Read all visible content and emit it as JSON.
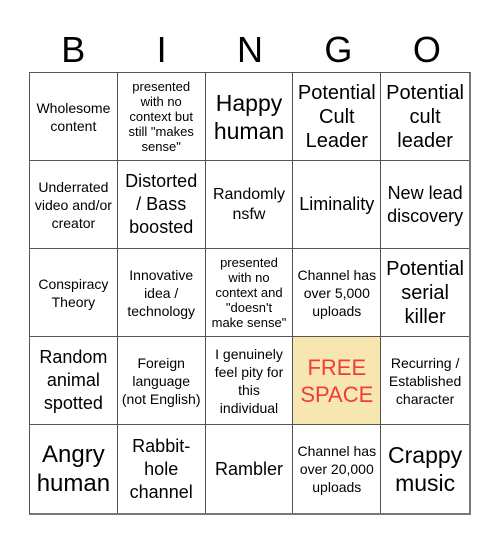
{
  "header": {
    "letters": [
      "B",
      "I",
      "N",
      "G",
      "O"
    ]
  },
  "free_space": {
    "background": "#f7e6b0",
    "text_color": "#f03c3c"
  },
  "cells": [
    {
      "text": "Wholesome content"
    },
    {
      "text": "presented with no context but still \"makes sense\""
    },
    {
      "text": "Happy human"
    },
    {
      "text": "Potential Cult Leader"
    },
    {
      "text": "Potential cult leader"
    },
    {
      "text": "Underrated video and/or creator"
    },
    {
      "text": "Distorted / Bass boosted"
    },
    {
      "text": "Randomly nsfw"
    },
    {
      "text": "Liminality"
    },
    {
      "text": "New lead discovery"
    },
    {
      "text": "Conspiracy Theory"
    },
    {
      "text": "Innovative idea / technology"
    },
    {
      "text": "presented with no context and \"doesn't make sense\""
    },
    {
      "text": "Channel has over 5,000 uploads"
    },
    {
      "text": "Potential serial killer"
    },
    {
      "text": "Random animal spotted"
    },
    {
      "text": "Foreign language (not English)"
    },
    {
      "text": "I genuinely feel pity for this individual"
    },
    {
      "text": "FREE SPACE",
      "free": true
    },
    {
      "text": "Recurring / Established character"
    },
    {
      "text": "Angry human"
    },
    {
      "text": "Rabbit-hole channel"
    },
    {
      "text": "Rambler"
    },
    {
      "text": "Channel has over 20,000 uploads"
    },
    {
      "text": "Crappy music"
    }
  ]
}
